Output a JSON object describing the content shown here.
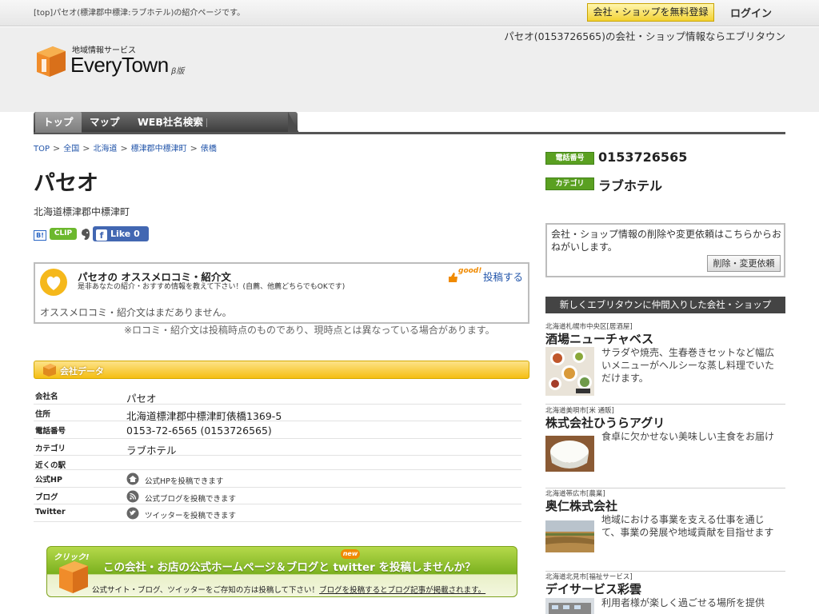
{
  "topbar": {
    "tagline": "[top]パセオ(標津郡中標津:ラブホテル)の紹介ページです。",
    "register_label": "会社・ショップを無料登録",
    "login_label": "ログイン"
  },
  "header": {
    "right_text": "パセオ(0153726565)の会社・ショップ情報ならエブリタウン",
    "logo_sub": "地域情報サービス",
    "logo_main": "EveryTown",
    "logo_beta": "β版"
  },
  "nav": {
    "items": [
      {
        "label": "トップ"
      },
      {
        "label": "マップ"
      },
      {
        "label": "WEB社名検索"
      }
    ]
  },
  "breadcrumb": {
    "items": [
      "TOP",
      "全国",
      "北海道",
      "標津郡中標津町",
      "俵橋"
    ]
  },
  "page": {
    "title": "パセオ",
    "address": "北海道標津郡中標津町"
  },
  "share": {
    "hatena": "B!",
    "clip": "CLIP",
    "like_label": "Like 0"
  },
  "review": {
    "title": "パセオの オススメロコミ・紹介文",
    "desc": "是非あなたの紹介・おすすめ情報を教えて下さい！(自薦、他薦どちらでもOKです)",
    "good_label": "good!",
    "post_label": "投稿する",
    "empty": "オススメロコミ・紹介文はまだありません。",
    "note": "※ロコミ・紹介文は投稿時点のものであり、現時点とは異なっている場合があります。"
  },
  "company": {
    "section_title": "会社データ",
    "rows": [
      {
        "key": "会社名",
        "value": "パセオ"
      },
      {
        "key": "住所",
        "value": "北海道標津郡中標津町俵橋1369-5"
      },
      {
        "key": "電話番号",
        "value": "0153-72-6565 (0153726565)"
      },
      {
        "key": "カテゴリ",
        "value": "ラブホテル"
      },
      {
        "key": "近くの駅",
        "value": ""
      },
      {
        "key": "公式HP",
        "value": "公式HPを投稿できます"
      },
      {
        "key": "ブログ",
        "value": "公式ブログを投稿できます"
      },
      {
        "key": "Twitter",
        "value": "ツイッターを投稿できます"
      }
    ]
  },
  "banner": {
    "click": "クリック!",
    "main": "この会社・お店の公式ホームページ＆ブログと twitter を投稿しませんか？",
    "new_tag": "new",
    "sub_plain": "公式サイト・ブログ、ツイッターをご存知の方は投稿して下さい！",
    "sub_link": "ブログを投稿するとブログ記事が掲載されます。"
  },
  "side": {
    "phone_label": "電話番号",
    "phone_value": "0153726565",
    "category_label": "カテゴリ",
    "category_value": "ラブホテル",
    "request_text": "会社・ショップ情報の削除や変更依頼はこちらからおねがいします。",
    "request_btn": "削除・変更依頼",
    "new_head": "新しくエブリタウンに仲間入りした会社・ショップ",
    "companies": [
      {
        "loc": "北海道札幌市中央区[居酒屋]",
        "name": "酒場ニューチャベス",
        "desc": "サラダや焼売、生春巻きセットなど幅広いメニューがヘルシーな蒸し料理でいただけます。"
      },
      {
        "loc": "北海道美唄市[米 通販]",
        "name": "株式会社ひうらアグリ",
        "desc": "食卓に欠かせない美味しい主食をお届け"
      },
      {
        "loc": "北海道帯広市[農業]",
        "name": "奥仁株式会社",
        "desc": "地域における事業を支える仕事を通じて、事業の発展や地域貢献を目指せます"
      },
      {
        "loc": "北海道北見市[福祉サービス]",
        "name": "デイサービス彩雲",
        "desc": "利用者様が楽しく過ごせる場所を提供"
      }
    ]
  },
  "colors": {
    "accent_green": "#5aa021",
    "accent_yellow": "#f5be12",
    "link_blue": "#2255aa",
    "nav_dark": "#3b3b3b"
  }
}
